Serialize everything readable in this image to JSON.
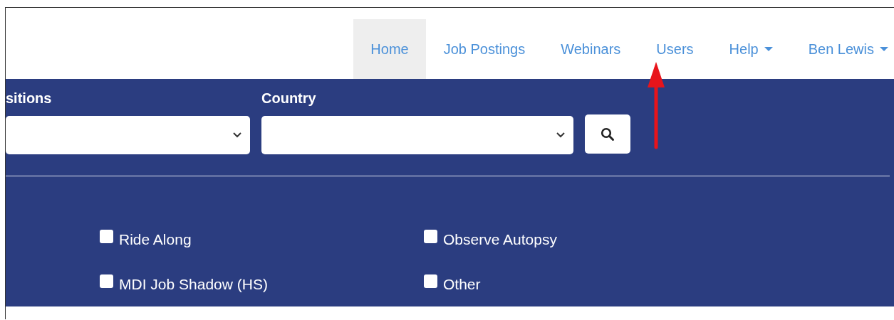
{
  "nav": [
    {
      "label": "Home",
      "selected": true,
      "dropdown": false
    },
    {
      "label": "Job Postings",
      "selected": false,
      "dropdown": false
    },
    {
      "label": "Webinars",
      "selected": false,
      "dropdown": false
    },
    {
      "label": "Users",
      "selected": false,
      "dropdown": false
    },
    {
      "label": "Help",
      "selected": false,
      "dropdown": true
    },
    {
      "label": "Ben Lewis",
      "selected": false,
      "dropdown": true
    }
  ],
  "filters": [
    {
      "label": "sitions"
    },
    {
      "label": "Country"
    }
  ],
  "options": [
    {
      "label": "Ride Along",
      "checked": false
    },
    {
      "label": "Observe Autopsy",
      "checked": false
    },
    {
      "label": "MDI Job Shadow (HS)",
      "checked": false
    },
    {
      "label": "Other",
      "checked": false
    }
  ]
}
